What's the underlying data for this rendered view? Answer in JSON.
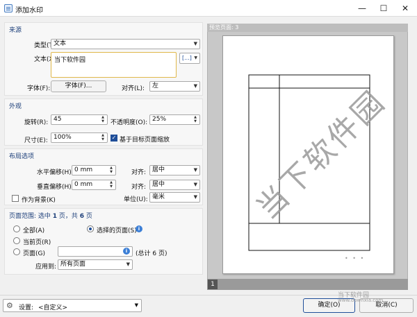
{
  "window": {
    "title": "添加水印",
    "minimize": "—",
    "maximize": "☐",
    "close": "✕"
  },
  "source": {
    "header": "来源",
    "type_label": "类型(T):",
    "type_value": "文本",
    "text_label": "文本(X):",
    "text_value": "当下软件园",
    "font_label": "字体(F):",
    "font_button": "字体(F)...",
    "align_label": "对齐(L):",
    "align_value": "左",
    "insert_button": "[...]"
  },
  "appearance": {
    "header": "外观",
    "rotation_label": "旋转(R):",
    "rotation_value": "45",
    "opacity_label": "不透明度(O):",
    "opacity_value": "25%",
    "size_label": "尺寸(E):",
    "size_value": "100%",
    "scale_label": "基于目标页面缩放",
    "scale_checked": true
  },
  "layout": {
    "header": "布局选项",
    "hoffset_label": "水平偏移(H):",
    "hoffset_value": "0 mm",
    "voffset_label": "垂直偏移(H):",
    "voffset_value": "0 mm",
    "halign_label": "对齐:",
    "halign_value": "居中",
    "valign_label": "对齐:",
    "valign_value": "居中",
    "unit_label": "单位(U):",
    "unit_value": "毫米",
    "background_label": "作为背景(K)",
    "background_checked": false
  },
  "range": {
    "header_prefix": "页面范围: 选中 ",
    "selected_count": "1",
    "header_mid": " 页，共 ",
    "total_count": "6",
    "header_suffix": " 页",
    "all_label": "全部(A)",
    "selected_label": "选择的页面(S)",
    "current_label": "当前页(R)",
    "pages_label": "页面(G)",
    "pages_value": "",
    "pages_total": "(总计 6 页)",
    "apply_label": "应用到:",
    "apply_value": "所有页面",
    "selected_option": "selected"
  },
  "preview": {
    "header": "预览页面: 3",
    "watermark_text": "当下软件园",
    "page_number": "1",
    "dots": "• • •"
  },
  "footer": {
    "settings_label": "设置:",
    "settings_value": "<自定义>",
    "ok": "确定(O)",
    "cancel": "取消(C)",
    "brand": "当下软件园",
    "brand_url": "www.downxia.com"
  },
  "colors": {
    "accent": "#1f4e99",
    "focus": "#e0b84a",
    "watermark": "#9a9a9a"
  }
}
